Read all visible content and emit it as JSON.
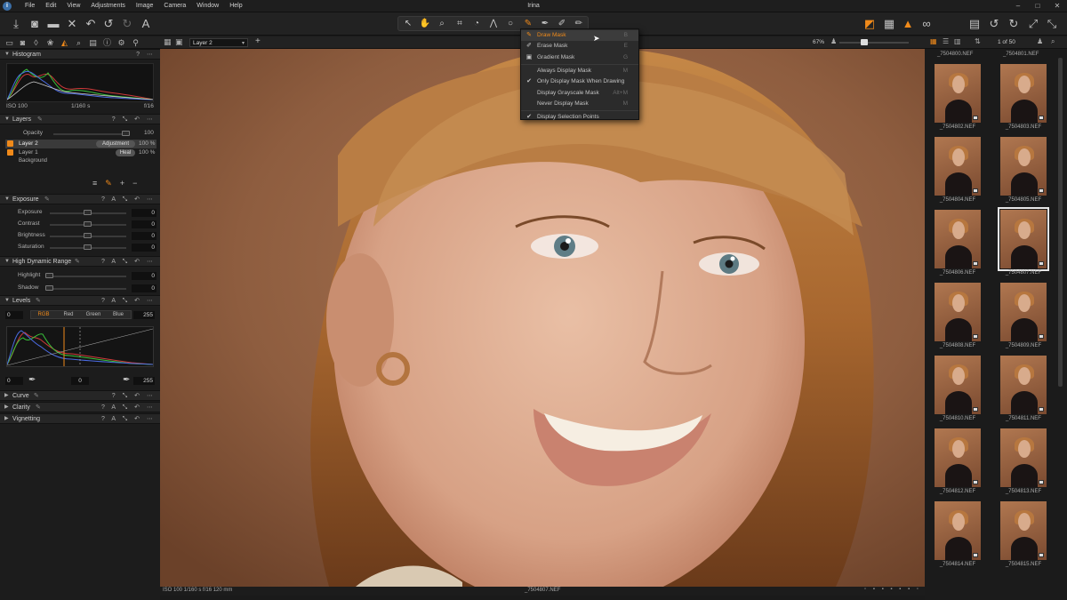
{
  "titlebar": {
    "app_initial": "i",
    "title": "Irina",
    "menu": [
      "File",
      "Edit",
      "View",
      "Adjustments",
      "Image",
      "Camera",
      "Window",
      "Help"
    ]
  },
  "colors": {
    "accent": "#f08a1a",
    "bg": "#1a1a1a",
    "panel": "#1c1c1c",
    "header": "#262626"
  },
  "viewer_bar": {
    "layer_select": "Layer 2",
    "zoom": "67%"
  },
  "histogram": {
    "title": "Histogram",
    "iso": "ISO 100",
    "shutter": "1/160 s",
    "aperture": "f/16"
  },
  "layers": {
    "title": "Layers",
    "opacity_label": "Opacity",
    "opacity_value": "100",
    "items": [
      {
        "name": "Layer 2",
        "tag": "Adjustment",
        "pct": "100 %"
      },
      {
        "name": "Layer 1",
        "tag": "Heal",
        "pct": "100 %"
      },
      {
        "name": "Background"
      }
    ]
  },
  "exposure": {
    "title": "Exposure",
    "rows": [
      {
        "label": "Exposure",
        "value": "0"
      },
      {
        "label": "Contrast",
        "value": "0"
      },
      {
        "label": "Brightness",
        "value": "0"
      },
      {
        "label": "Saturation",
        "value": "0"
      }
    ]
  },
  "hdr": {
    "title": "High Dynamic Range",
    "rows": [
      {
        "label": "Highlight",
        "value": "0"
      },
      {
        "label": "Shadow",
        "value": "0"
      }
    ]
  },
  "levels": {
    "title": "Levels",
    "low": "0",
    "high": "255",
    "out_low": "0",
    "mid": "0",
    "out_high": "255",
    "channels": [
      "RGB",
      "Red",
      "Green",
      "Blue"
    ]
  },
  "collapsed_tools": [
    "Curve",
    "Clarity",
    "Vignetting"
  ],
  "mask_menu": {
    "items": [
      {
        "icon": "brush-icon",
        "label": "Draw Mask",
        "shortcut": "B",
        "active": true
      },
      {
        "icon": "eraser-icon",
        "label": "Erase Mask",
        "shortcut": "E"
      },
      {
        "icon": "gradient-icon",
        "label": "Gradient Mask",
        "shortcut": "G"
      },
      {
        "sep": true
      },
      {
        "label": "Always Display Mask",
        "shortcut": "M"
      },
      {
        "label": "Only Display Mask When Drawing",
        "checked": true
      },
      {
        "label": "Display Grayscale Mask",
        "shortcut": "Alt+M"
      },
      {
        "label": "Never Display Mask",
        "shortcut": "M"
      },
      {
        "sep": true
      },
      {
        "label": "Display Selection Points",
        "checked": true
      }
    ]
  },
  "viewer_status": {
    "info": "ISO 100  1/160 s  f/16  120 mm",
    "filename": "_7504807.NEF"
  },
  "browser": {
    "counter": "1 of 50",
    "top_labels": [
      "_7504800.NEF",
      "_7504801.NEF"
    ],
    "items": [
      "_7504802.NEF",
      "_7504803.NEF",
      "_7504804.NEF",
      "_7504805.NEF",
      "_7504806.NEF",
      "_7504807.NEF",
      "_7504808.NEF",
      "_7504809.NEF",
      "_7504810.NEF",
      "_7504811.NEF",
      "_7504812.NEF",
      "_7504813.NEF",
      "_7504814.NEF",
      "_7504815.NEF"
    ],
    "selected": "_7504807.NEF"
  }
}
